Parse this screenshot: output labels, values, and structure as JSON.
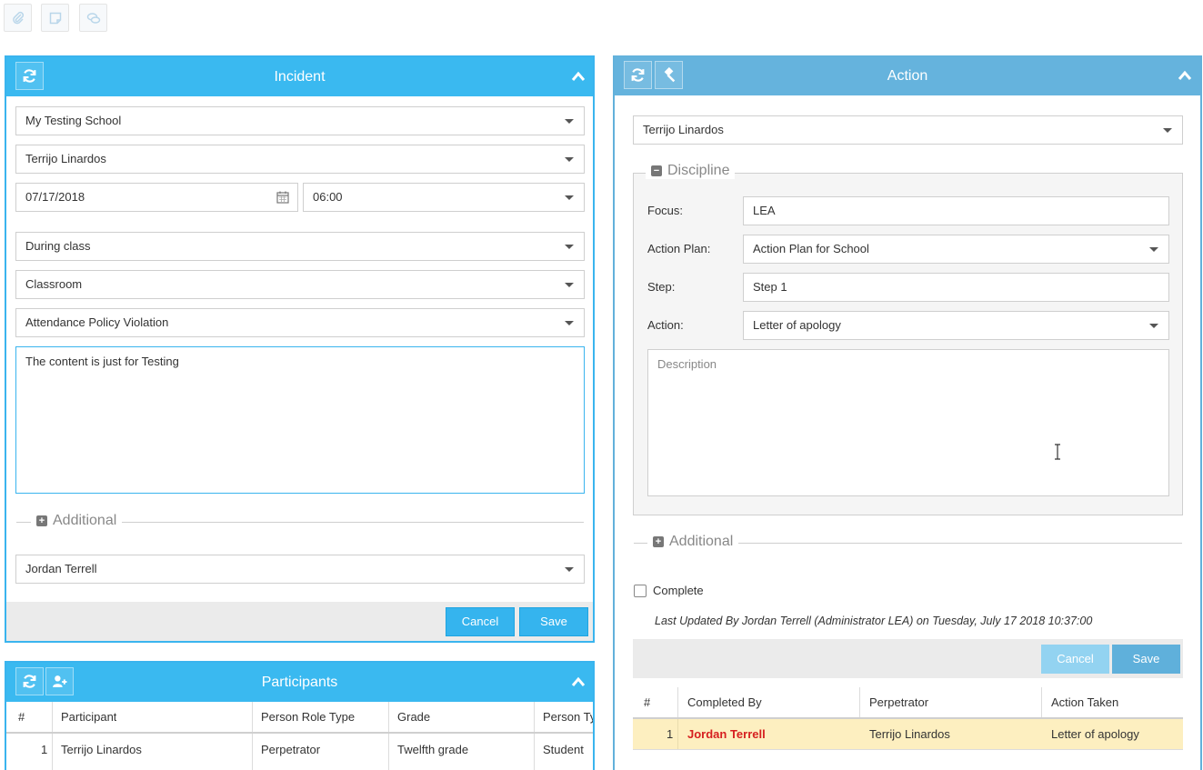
{
  "toolbar": {
    "buttons": [
      {
        "icon": "paperclip-icon"
      },
      {
        "icon": "sticky-note-icon"
      },
      {
        "icon": "comments-icon"
      }
    ]
  },
  "incident": {
    "title": "Incident",
    "school": "My Testing School",
    "person": "Terrijo Linardos",
    "date": "07/17/2018",
    "time": "06:00",
    "when": "During class",
    "location": "Classroom",
    "behavior": "Attendance Policy Violation",
    "description": "The content is just for Testing",
    "additional_label": "Additional",
    "reported_by": "Jordan Terrell",
    "cancel_label": "Cancel",
    "save_label": "Save"
  },
  "participants": {
    "title": "Participants",
    "columns": [
      "#",
      "Participant",
      "Person Role Type",
      "Grade",
      "Person Ty"
    ],
    "rows": [
      {
        "num": "1",
        "participant": "Terrijo Linardos",
        "role": "Perpetrator",
        "grade": "Twelfth grade",
        "type": "Student"
      }
    ]
  },
  "action": {
    "title": "Action",
    "person": "Terrijo Linardos",
    "discipline_label": "Discipline",
    "focus_label": "Focus:",
    "focus_value": "LEA",
    "plan_label": "Action Plan:",
    "plan_value": "Action Plan for School",
    "step_label": "Step:",
    "step_value": "Step 1",
    "action_label": "Action:",
    "action_value": "Letter of apology",
    "description_placeholder": "Description",
    "additional_label": "Additional",
    "complete_label": "Complete",
    "last_updated": "Last Updated By Jordan Terrell (Administrator LEA) on Tuesday, July 17 2018 10:37:00",
    "cancel_label": "Cancel",
    "save_label": "Save",
    "table": {
      "columns": [
        "#",
        "Completed By",
        "Perpetrator",
        "Action Taken"
      ],
      "rows": [
        {
          "num": "1",
          "completed_by": "Jordan Terrell",
          "perpetrator": "Terrijo Linardos",
          "action_taken": "Letter of apology"
        }
      ]
    }
  },
  "colors": {
    "header_blue": "#3ab9f0",
    "action_header_blue": "#65b3dd",
    "highlight_row": "#fdefc0",
    "name_red": "#d61f1f"
  }
}
